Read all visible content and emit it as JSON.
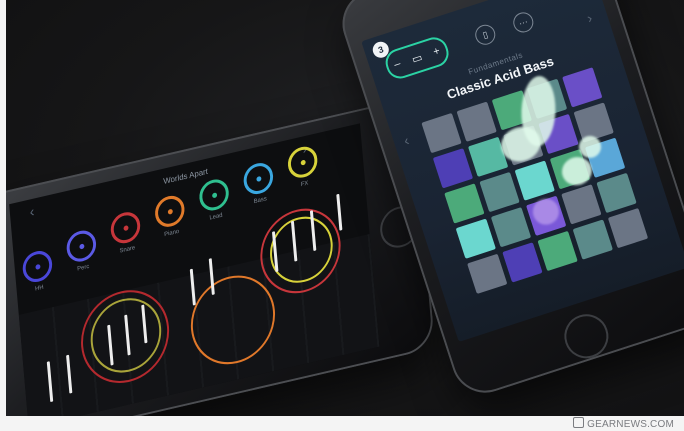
{
  "right_phone": {
    "logo_glyph": "3",
    "pill_minus": "–",
    "pill_plus": "+",
    "pill_middle": "▭",
    "icon_one": "▯",
    "icon_more": "···",
    "subtitle": "Fundamentals",
    "preset_name": "Classic Acid Bass",
    "arrow_left": "‹",
    "arrow_right": "›",
    "pad_colors": [
      "#6b7585",
      "#6b7585",
      "#4caa7a",
      "#5b8a8a",
      "#6a4fc7",
      "#4e3fb5",
      "#56b9a3",
      "#6b7585",
      "#6a4fc7",
      "#6b7585",
      "#4caa7a",
      "#5b8a8a",
      "#6bd7cf",
      "#4caa7a",
      "#5aa7d8",
      "#6bd7cf",
      "#5b8a8a",
      "#7a58d8",
      "#6b7585",
      "#5b8a8a",
      "#6b7585",
      "#4e3fb5",
      "#4caa7a",
      "#5b8a8a",
      "#6b7585"
    ]
  },
  "left_phone": {
    "track_title": "Worlds Apart",
    "nav_left": "‹",
    "nav_right": "›",
    "knobs": [
      {
        "label": "HH",
        "color": "#4a47d9"
      },
      {
        "label": "Perc",
        "color": "#5b5ae6"
      },
      {
        "label": "Snare",
        "color": "#c7363b"
      },
      {
        "label": "Piano",
        "color": "#e07a2a"
      },
      {
        "label": "Lead",
        "color": "#2fbf8f"
      },
      {
        "label": "Bass",
        "color": "#3aa7e0"
      },
      {
        "label": "FX",
        "color": "#d7d23a"
      }
    ]
  },
  "watermark": "GEARNEWS.COM"
}
